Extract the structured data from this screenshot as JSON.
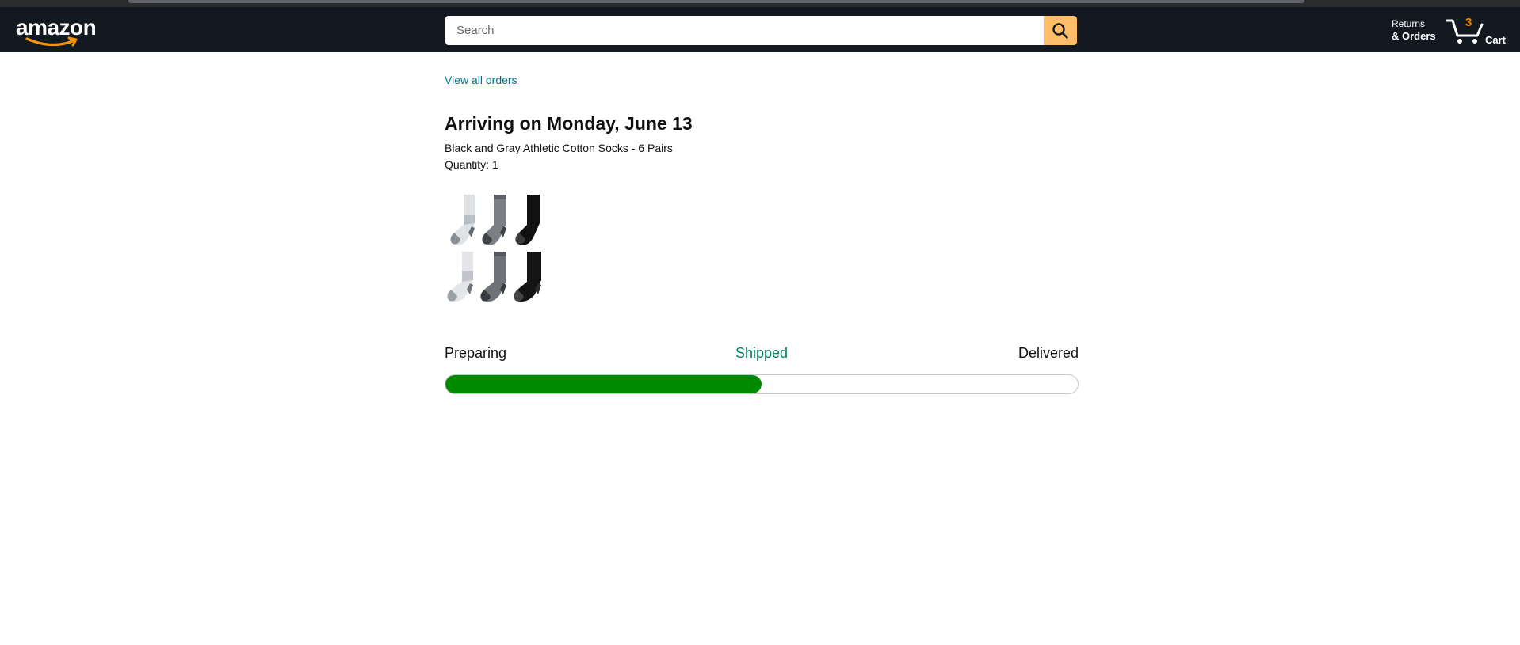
{
  "header": {
    "logo_text": "amazon",
    "search": {
      "placeholder": "Search",
      "value": ""
    },
    "returns": {
      "line1": "Returns",
      "line2": "& Orders"
    },
    "cart": {
      "count": "3",
      "label": "Cart"
    }
  },
  "order": {
    "view_all_label": "View all orders",
    "arrival_title": "Arriving on Monday, June 13",
    "product_name": "Black and Gray Athletic Cotton Socks - 6 Pairs",
    "quantity_text": "Quantity: 1"
  },
  "tracking": {
    "steps": [
      "Preparing",
      "Shipped",
      "Delivered"
    ],
    "current_step": "Shipped",
    "progress_fraction": 0.5
  },
  "colors": {
    "header_bg": "#131921",
    "search_button": "#febd69",
    "cart_count": "#f08804",
    "link": "#007185",
    "shipped_text": "#067d62",
    "progress_fill": "#008a00"
  },
  "icons": {
    "search": "search-icon",
    "cart": "cart-icon",
    "logo_smile": "amazon-smile-icon"
  }
}
